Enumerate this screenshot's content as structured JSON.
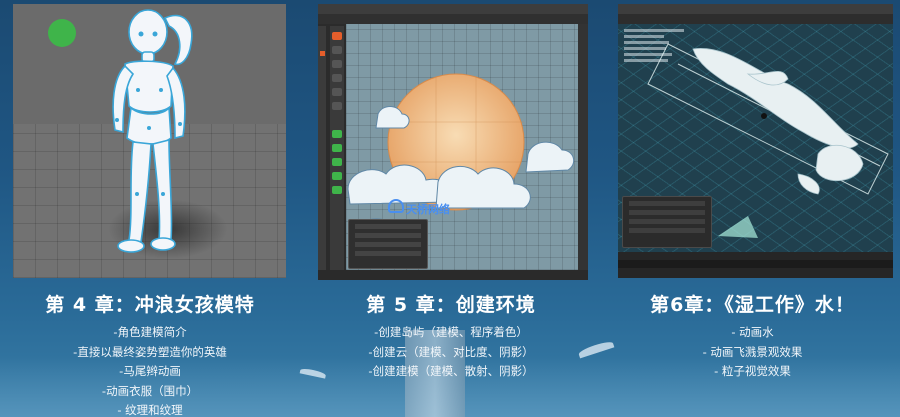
{
  "panel_1": {
    "title": "第 4 章：冲浪女孩模特",
    "items": [
      "-角色建模简介",
      "-直接以最终姿势塑造你的英雄",
      "-马尾辫动画",
      "-动画衣服（围巾）",
      "- 纹理和纹理"
    ]
  },
  "panel_2": {
    "title": "第 5 章：创建环境",
    "items": [
      "-创建岛屿（建模、程序着色）",
      "-创建云（建模、对比度、阴影）",
      "-创建建模（建模、散射、阴影）"
    ],
    "watermark": "天桥网络"
  },
  "panel_3": {
    "title": "第6章：《湿工作》水！",
    "items": [
      "- 动画水",
      "- 动画飞溅景观效果",
      "- 粒子视觉效果"
    ]
  },
  "colors": {
    "background": "#1f5683",
    "accent_green": "#3fb44a",
    "blender_orange": "#e55e2b",
    "watermark_blue": "#4a8ff0"
  }
}
